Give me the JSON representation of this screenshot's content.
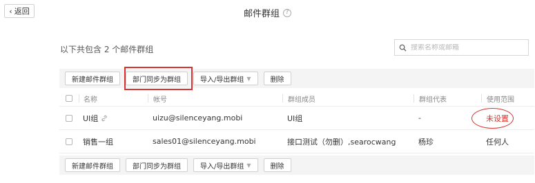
{
  "header": {
    "back_label": "返回",
    "title": "邮件群组",
    "help_icon": "question-circle-icon"
  },
  "summary_text": "以下共包含 2 个邮件群组",
  "search": {
    "placeholder": "搜索名称或邮箱",
    "value": ""
  },
  "toolbar": {
    "new_group": "新建邮件群组",
    "dept_sync": "部门同步为群组",
    "import_export": "导入/导出群组",
    "delete": "删除"
  },
  "table": {
    "columns": [
      "名称",
      "帐号",
      "群组成员",
      "群组代表",
      "使用范围"
    ],
    "rows": [
      {
        "name": "UI组",
        "account": "uizu@silenceyang.mobi",
        "members": "UI组",
        "rep": "-",
        "scope": "未设置"
      },
      {
        "name": "销售一组",
        "account": "sales01@silenceyang.mobi",
        "members": "接口测试（勿删）,searocwang",
        "rep": "杨珍",
        "scope": "任何人"
      }
    ]
  },
  "colors": {
    "accent_red": "#d9322e",
    "toolbar_bg": "#f4f4f4"
  }
}
